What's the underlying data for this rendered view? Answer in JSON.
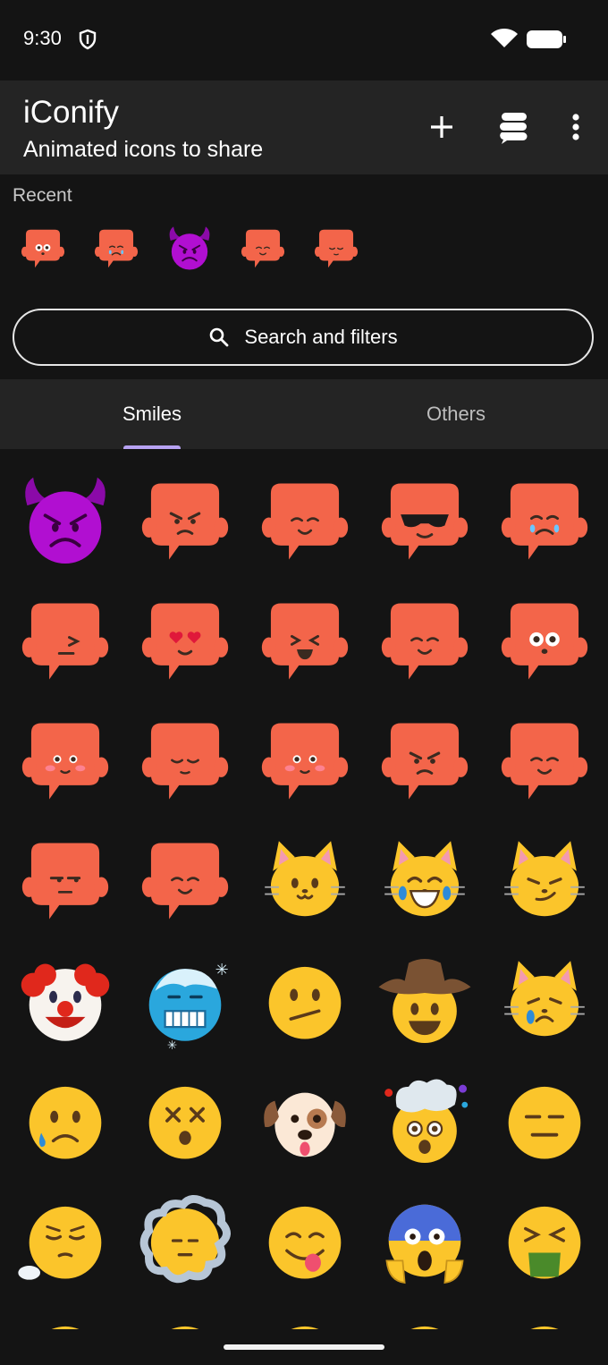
{
  "status_bar": {
    "time": "9:30"
  },
  "app_bar": {
    "title": "iConify",
    "subtitle": "Animated icons to share",
    "actions": [
      "add-icon",
      "stack-icon",
      "more-vert-icon"
    ]
  },
  "recent": {
    "label": "Recent",
    "items": [
      {
        "name": "blob-wide-eyes-icon",
        "kind": "blob",
        "face": "wide"
      },
      {
        "name": "blob-crying-icon",
        "kind": "blob",
        "face": "cry"
      },
      {
        "name": "angry-devil-icon",
        "kind": "devil"
      },
      {
        "name": "blob-hands-mouth-icon",
        "kind": "blob",
        "face": "smile"
      },
      {
        "name": "blob-content-icon",
        "kind": "blob",
        "face": "calm"
      }
    ]
  },
  "search": {
    "label": "Search and filters"
  },
  "tabs": {
    "smiles": "Smiles",
    "others": "Others"
  },
  "colors": {
    "accent": "#b7a2f2",
    "blob": "#f3654a",
    "emoji": "#fbc52b",
    "devil": "#b10fd1",
    "background": "#141414",
    "surface": "#242424"
  },
  "grid": [
    {
      "name": "angry-devil-icon",
      "kind": "devil"
    },
    {
      "name": "blob-angry-icon",
      "kind": "blob",
      "face": "angry"
    },
    {
      "name": "blob-pleading-icon",
      "kind": "blob",
      "face": "smile"
    },
    {
      "name": "blob-sunglasses-icon",
      "kind": "blob",
      "face": "cool"
    },
    {
      "name": "blob-crying-icon",
      "kind": "blob",
      "face": "cry"
    },
    {
      "name": "blob-facepalm-icon",
      "kind": "blob",
      "face": "wince"
    },
    {
      "name": "blob-heart-eyes-icon",
      "kind": "blob",
      "face": "love"
    },
    {
      "name": "blob-laughing-icon",
      "kind": "blob",
      "face": "laugh"
    },
    {
      "name": "blob-party-icon",
      "kind": "blob",
      "face": "smile"
    },
    {
      "name": "blob-wide-eyes-icon",
      "kind": "blob",
      "face": "wide"
    },
    {
      "name": "blob-blushing-icon",
      "kind": "blob",
      "face": "blush"
    },
    {
      "name": "blob-sleepy-icon",
      "kind": "blob",
      "face": "calm"
    },
    {
      "name": "blob-thinking-icon",
      "kind": "blob",
      "face": "blush"
    },
    {
      "name": "blob-thumbs-down-icon",
      "kind": "blob",
      "face": "angry"
    },
    {
      "name": "blob-thumbs-up-icon",
      "kind": "blob",
      "face": "smile"
    },
    {
      "name": "blob-unamused-icon",
      "kind": "blob",
      "face": "meh"
    },
    {
      "name": "blob-waving-icon",
      "kind": "blob",
      "face": "smile"
    },
    {
      "name": "cat-smile-icon",
      "kind": "cat",
      "face": "smile"
    },
    {
      "name": "cat-tears-of-joy-icon",
      "kind": "cat",
      "face": "laugh"
    },
    {
      "name": "cat-smirk-icon",
      "kind": "cat",
      "face": "smirk"
    },
    {
      "name": "clown-face-icon",
      "kind": "clown"
    },
    {
      "name": "cold-face-icon",
      "kind": "cold"
    },
    {
      "name": "confused-face-icon",
      "kind": "emoji",
      "face": "confused"
    },
    {
      "name": "cowboy-face-icon",
      "kind": "cowboy"
    },
    {
      "name": "crying-cat-icon",
      "kind": "cat",
      "face": "cry"
    },
    {
      "name": "sad-relieved-face-icon",
      "kind": "emoji",
      "face": "sad"
    },
    {
      "name": "dizzy-face-icon",
      "kind": "emoji",
      "face": "dizzy"
    },
    {
      "name": "dog-face-icon",
      "kind": "dog"
    },
    {
      "name": "exploding-head-icon",
      "kind": "explode"
    },
    {
      "name": "expressionless-face-icon",
      "kind": "emoji",
      "face": "flat"
    },
    {
      "name": "face-exhaling-icon",
      "kind": "emoji",
      "face": "exhale"
    },
    {
      "name": "face-in-clouds-icon",
      "kind": "clouds"
    },
    {
      "name": "yum-face-icon",
      "kind": "emoji",
      "face": "yum"
    },
    {
      "name": "screaming-face-icon",
      "kind": "scream"
    },
    {
      "name": "vomiting-face-icon",
      "kind": "emoji",
      "face": "vomit"
    },
    {
      "name": "emoji-partial-1-icon",
      "kind": "emoji",
      "face": "flat"
    },
    {
      "name": "emoji-partial-2-icon",
      "kind": "emoji",
      "face": "flat"
    },
    {
      "name": "emoji-partial-3-icon",
      "kind": "emoji",
      "face": "flat"
    },
    {
      "name": "emoji-partial-4-icon",
      "kind": "emoji",
      "face": "flat"
    },
    {
      "name": "emoji-partial-5-icon",
      "kind": "emoji",
      "face": "flat"
    }
  ]
}
